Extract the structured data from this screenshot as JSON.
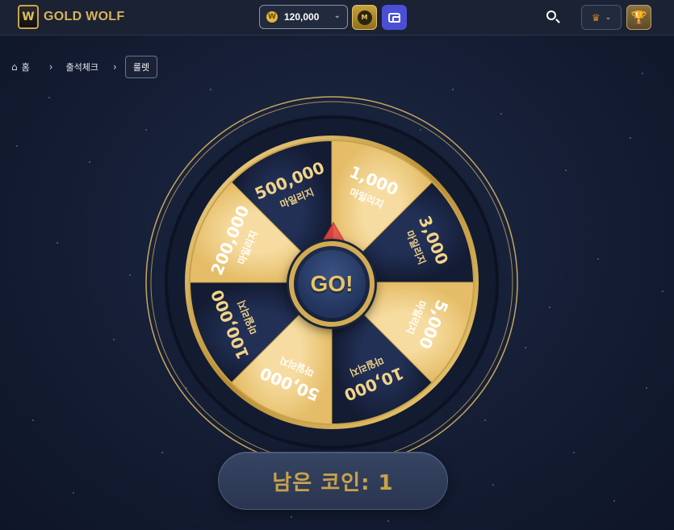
{
  "header": {
    "logo_mark": "W",
    "logo_text": "GOLD WOLF",
    "coin_symbol": "W",
    "coin_amount": "120,000",
    "coin_chevron": "⌄",
    "m_badge": "M",
    "lang_chevron": "⌄",
    "trophy": "🏆",
    "lang_flag": "♛"
  },
  "breadcrumb": {
    "home_icon": "⌂",
    "home": "홈",
    "sep": "›",
    "attendance": "출석체크",
    "current": "룰렛"
  },
  "wheel": {
    "go_label": "GO!",
    "segments": [
      {
        "amount": "1,000",
        "unit": "마일리지",
        "color": "#efcf86"
      },
      {
        "amount": "3,000",
        "unit": "마일리지",
        "color": "#18223d"
      },
      {
        "amount": "5,000",
        "unit": "마일리지",
        "color": "#efcf86"
      },
      {
        "amount": "10,000",
        "unit": "마일리지",
        "color": "#18223d"
      },
      {
        "amount": "50,000",
        "unit": "마일리지",
        "color": "#efcf86"
      },
      {
        "amount": "100,000",
        "unit": "마일리지",
        "color": "#18223d"
      },
      {
        "amount": "200,000",
        "unit": "마일리지",
        "color": "#efcf86"
      },
      {
        "amount": "500,000",
        "unit": "마일리지",
        "color": "#18223d"
      }
    ]
  },
  "counter": {
    "label": "남은 코인: 1"
  },
  "colors": {
    "gold": "#d2ac55",
    "navy": "#18223d",
    "light_gold": "#efcf86"
  }
}
